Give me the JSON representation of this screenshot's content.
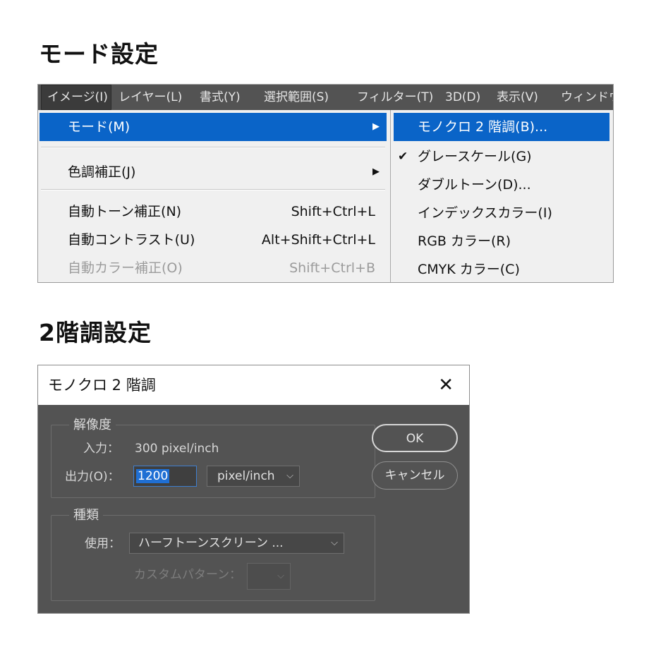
{
  "headings": {
    "mode": "モード設定",
    "bitmap": "2階調設定"
  },
  "menubar": {
    "items": [
      "イメージ(I)",
      "レイヤー(L)",
      "書式(Y)",
      "選択範囲(S)",
      "フィルター(T)",
      "3D(D)",
      "表示(V)",
      "ウィンドウ"
    ],
    "active_index": 0
  },
  "image_menu": {
    "mode": "モード(M)",
    "adjustments": "色調補正(J)",
    "auto_tone": {
      "label": "自動トーン補正(N)",
      "shortcut": "Shift+Ctrl+L"
    },
    "auto_contrast": {
      "label": "自動コントラスト(U)",
      "shortcut": "Alt+Shift+Ctrl+L"
    },
    "auto_color": {
      "label": "自動カラー補正(O)",
      "shortcut": "Shift+Ctrl+B",
      "enabled": false
    }
  },
  "mode_submenu": {
    "items": [
      "モノクロ 2 階調(B)...",
      "グレースケール(G)",
      "ダブルトーン(D)...",
      "インデックスカラー(I)",
      "RGB カラー(R)",
      "CMYK カラー(C)"
    ],
    "highlighted_index": 0,
    "checked_index": 1
  },
  "dialog": {
    "title": "モノクロ 2 階調",
    "resolution": {
      "legend": "解像度",
      "input_label": "入力：",
      "input_value": "300 pixel/inch",
      "output_label": "出力(O)：",
      "output_value": "1200",
      "unit": "pixel/inch"
    },
    "method": {
      "legend": "種類",
      "use_label": "使用：",
      "use_value": "ハーフトーンスクリーン ...",
      "custom_label": "カスタムパターン："
    },
    "ok": "OK",
    "cancel": "キャンセル"
  },
  "colors": {
    "highlight": "#0a64c8",
    "dialog_bg": "#535353",
    "menubar_bg": "#535353"
  }
}
